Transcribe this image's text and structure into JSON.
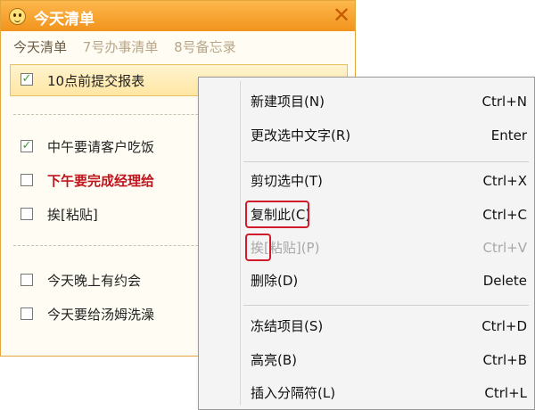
{
  "window": {
    "title": "今天清单",
    "close_glyph": "✕",
    "tabs": [
      {
        "label": "今天清单",
        "active": true
      },
      {
        "label": "7号办事清单",
        "active": false
      },
      {
        "label": "8号备忘录",
        "active": false
      }
    ]
  },
  "tasks": [
    {
      "text": "10点前提交报表",
      "checked": true,
      "selected": true
    },
    {
      "text": "中午要请客户吃饭",
      "checked": true
    },
    {
      "text": "下午要完成经理给",
      "checked": false,
      "emphasis": "red-bold"
    },
    {
      "text": "挨[粘贴]",
      "checked": false
    },
    {
      "text": "今天晚上有约会",
      "checked": false
    },
    {
      "text": "今天要给汤姆洗澡",
      "checked": false
    }
  ],
  "context_menu": {
    "items": [
      {
        "label": "新建项目(N)",
        "shortcut": "Ctrl+N",
        "enabled": true
      },
      {
        "label": "更改选中文字(R)",
        "shortcut": "Enter",
        "enabled": true
      },
      {
        "label": "剪切选中(T)",
        "shortcut": "Ctrl+X",
        "enabled": true
      },
      {
        "label": "复制此(C)",
        "shortcut": "Ctrl+C",
        "enabled": true,
        "highlighted_part": "复制此"
      },
      {
        "label": "挨[粘贴](P)",
        "shortcut": "Ctrl+V",
        "enabled": false,
        "highlighted_part": "挨"
      },
      {
        "label": "删除(D)",
        "shortcut": "Delete",
        "enabled": true
      },
      {
        "label": "冻结项目(S)",
        "shortcut": "Ctrl+D",
        "enabled": true
      },
      {
        "label": "高亮(B)",
        "shortcut": "Ctrl+B",
        "enabled": true
      },
      {
        "label": "插入分隔符(L)",
        "shortcut": "Ctrl+L",
        "enabled": true
      }
    ]
  },
  "colors": {
    "title_bar": "#f6a42f",
    "selected_row": "#ffe9a8",
    "emphasis_red": "#c0141e",
    "annotation_red": "#d01c2a",
    "check_green": "#3aa52b"
  }
}
